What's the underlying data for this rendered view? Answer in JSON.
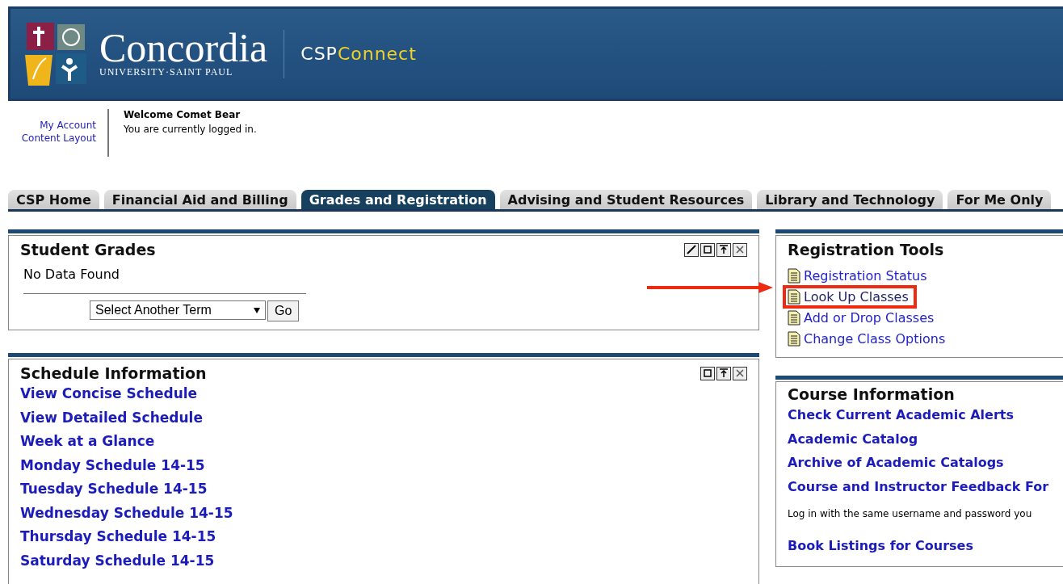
{
  "header": {
    "logo_name": "Concordia",
    "logo_subtitle": "UNIVERSITY·SAINT PAUL",
    "app_prefix": "CSP",
    "app_suffix": "Connect"
  },
  "account_links": [
    "My Account",
    "Content Layout"
  ],
  "welcome": {
    "title": "Welcome Comet Bear",
    "message": "You are currently logged in."
  },
  "tabs": [
    {
      "label": "CSP Home",
      "selected": false
    },
    {
      "label": "Financial Aid and Billing",
      "selected": false
    },
    {
      "label": "Grades and Registration",
      "selected": true
    },
    {
      "label": "Advising and Student Resources",
      "selected": false
    },
    {
      "label": "Library and Technology",
      "selected": false
    },
    {
      "label": "For Me Only",
      "selected": false
    }
  ],
  "student_grades": {
    "title": "Student Grades",
    "controls": [
      {
        "kind": "edit"
      },
      {
        "kind": "restore"
      },
      {
        "kind": "move-up"
      },
      {
        "kind": "close"
      }
    ],
    "message": "No Data Found",
    "term_select": {
      "value": "Select Another Term"
    },
    "go_button": "Go"
  },
  "schedule_information": {
    "title": "Schedule Information",
    "controls": [
      {
        "kind": "restore"
      },
      {
        "kind": "move-up"
      },
      {
        "kind": "close"
      }
    ],
    "links": [
      "View Concise Schedule",
      "View Detailed Schedule",
      "Week at a Glance",
      "Monday Schedule 14-15",
      "Tuesday Schedule 14-15",
      "Wednesday Schedule 14-15",
      "Thursday Schedule 14-15",
      "Saturday Schedule 14-15"
    ]
  },
  "registration_tools": {
    "title": "Registration Tools",
    "links": [
      {
        "label": "Registration Status",
        "highlighted": false
      },
      {
        "label": "Look Up Classes",
        "highlighted": true
      },
      {
        "label": "Add or Drop Classes",
        "highlighted": false
      },
      {
        "label": "Change Class Options",
        "highlighted": false
      }
    ]
  },
  "course_information": {
    "title": "Course Information",
    "items": [
      {
        "kind": "link",
        "text": "Check Current Academic Alerts"
      },
      {
        "kind": "link",
        "text": "Academic Catalog"
      },
      {
        "kind": "link",
        "text": "Archive of Academic Catalogs"
      },
      {
        "kind": "link",
        "text": "Course and Instructor Feedback For"
      },
      {
        "kind": "note",
        "text": "Log in with the same username and password you"
      },
      {
        "kind": "link",
        "text": "Book Listings for Courses"
      }
    ]
  }
}
